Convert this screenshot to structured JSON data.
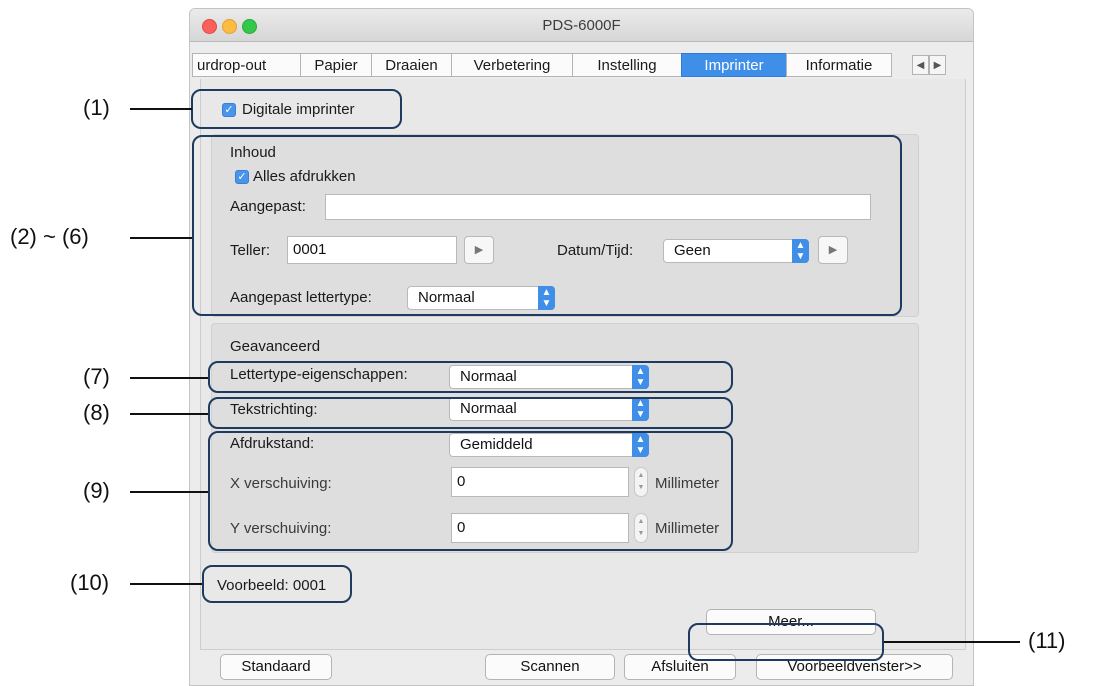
{
  "window": {
    "title": "PDS-6000F",
    "traffic_lights": {
      "close": "#fc605c",
      "minimize": "#fdbc40",
      "zoom": "#34c84a"
    },
    "accent": "#3f8fe8"
  },
  "tabs": [
    {
      "label": "urdrop-out",
      "active": false
    },
    {
      "label": "Papier",
      "active": false
    },
    {
      "label": "Draaien",
      "active": false
    },
    {
      "label": "Verbetering",
      "active": false
    },
    {
      "label": "Instelling",
      "active": false
    },
    {
      "label": "Imprinter",
      "active": true
    },
    {
      "label": "Informatie",
      "active": false
    }
  ],
  "tab_arrows": {
    "left": "◀",
    "right": "▶"
  },
  "digital_imprinter": {
    "label": "Digitale imprinter",
    "checked": true
  },
  "inhoud": {
    "heading": "Inhoud",
    "print_all": {
      "label": "Alles afdrukken",
      "checked": true
    },
    "custom": {
      "label": "Aangepast:",
      "value": ""
    },
    "counter": {
      "label": "Teller:",
      "value": "0001"
    },
    "datetime": {
      "label": "Datum/Tijd:",
      "value": "Geen"
    },
    "custom_font": {
      "label": "Aangepast lettertype:",
      "value": "Normaal"
    }
  },
  "advanced": {
    "heading": "Geavanceerd",
    "font_properties": {
      "label": "Lettertype-eigenschappen:",
      "value": "Normaal"
    },
    "text_direction": {
      "label": "Tekstrichting:",
      "value": "Normaal"
    },
    "print_position": {
      "label": "Afdrukstand:",
      "value": "Gemiddeld"
    },
    "x_offset": {
      "label": "X verschuiving:",
      "value": "0",
      "unit": "Millimeter"
    },
    "y_offset": {
      "label": "Y verschuiving:",
      "value": "0",
      "unit": "Millimeter"
    }
  },
  "preview": {
    "label": "Voorbeeld:",
    "value": "0001"
  },
  "more_button": "Meer...",
  "bottom_buttons": {
    "default": "Standaard",
    "scan": "Scannen",
    "close": "Afsluiten",
    "preview_window": "Voorbeeldvenster>>"
  },
  "callouts": {
    "c1": "(1)",
    "c2_6": "(2) ~ (6)",
    "c7": "(7)",
    "c8": "(8)",
    "c9": "(9)",
    "c10": "(10)",
    "c11": "(11)"
  },
  "icons": {
    "check": "✓",
    "play": "▶",
    "select_up": "▲",
    "select_down": "▼"
  }
}
